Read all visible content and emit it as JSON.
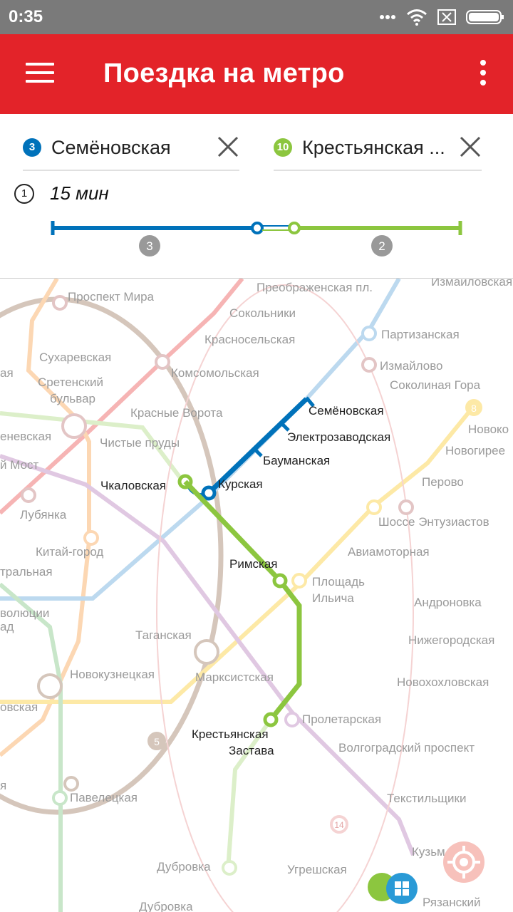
{
  "status_bar": {
    "time": "0:35"
  },
  "app_bar": {
    "title": "Поездка на метро"
  },
  "route": {
    "from": {
      "line": "3",
      "station": "Семёновская",
      "color": "#0072ba"
    },
    "to": {
      "line": "10",
      "station": "Крестьянская ...",
      "color": "#8cc63f"
    },
    "time_icon": "1",
    "duration": "15 мин",
    "segments": [
      {
        "stops": "3",
        "color": "#0072ba"
      },
      {
        "stops": "2",
        "color": "#8cc63f"
      }
    ]
  },
  "map": {
    "stations_faded": [
      "Проспект Мира",
      "Преображенская пл.",
      "Измайловская",
      "Сокольники",
      "Партизанская",
      "Красносельская",
      "Измайлово",
      "Сухаревская",
      "ая",
      "Комсомольская",
      "Соколиная Гора",
      "Сретенский",
      "бульвар",
      "Красные Ворота",
      "8",
      "Новоко",
      "еневская",
      "Чистые пруды",
      "Новогирее",
      "й Мост",
      "Перово",
      "Лубянка",
      "Шоссе Энтузиастов",
      "Китай-город",
      "Авиамоторная",
      "тральная",
      "Площадь",
      "Ильича",
      "волюции",
      "ад",
      "Андроновка",
      "Нижегородская",
      "Таганская",
      "Новокузнецкая",
      "Марксистская",
      "Новохохловская",
      "овская",
      "Пролетарская",
      "5",
      "Волгоградский проспект",
      "я",
      "Павелецкая",
      "Текстильщики",
      "14",
      "Кузьм",
      "Дубровка",
      "Угрешская",
      "Дубровка",
      "Рязанский"
    ],
    "stations_route": [
      "Семёновская",
      "Электрозаводская",
      "Бауманская",
      "Чкаловская",
      "Курская",
      "Римская",
      "Крестьянская",
      "Застава"
    ]
  },
  "icons": {
    "menu": "menu-icon",
    "more": "more-vert-icon",
    "clear": "close-icon",
    "locate": "locate-icon",
    "wifi": "wifi-icon",
    "battery": "battery-icon"
  }
}
